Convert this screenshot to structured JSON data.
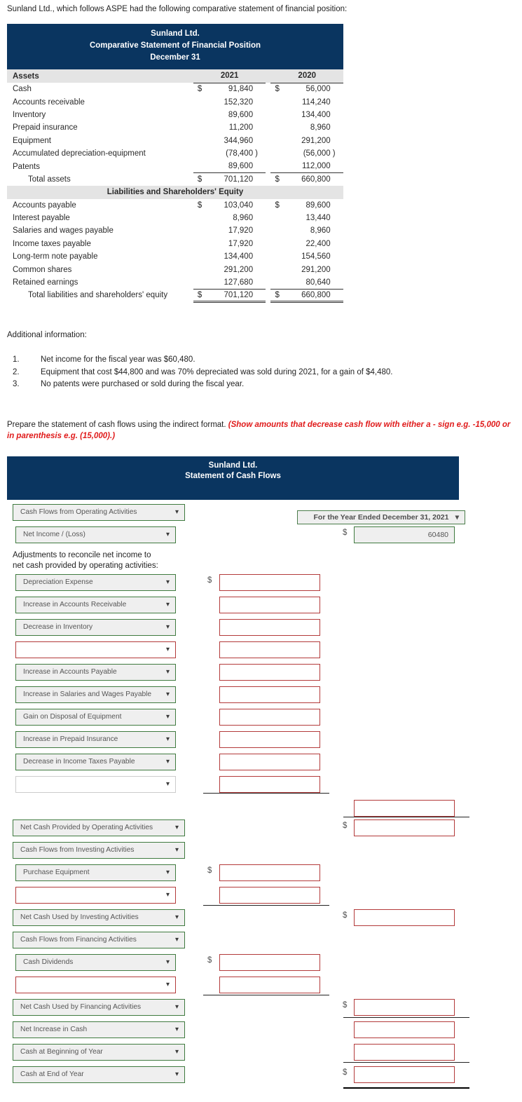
{
  "intro": "Sunland Ltd., which follows ASPE had the following comparative statement of financial position:",
  "balance_sheet": {
    "title_line1": "Sunland Ltd.",
    "title_line2": "Comparative Statement of Financial Position",
    "title_line3": "December 31",
    "col_header_label": "Assets",
    "year_2021": "2021",
    "year_2020": "2020",
    "section_band": "Liabilities and Shareholders' Equity",
    "currency": "$",
    "assets": [
      {
        "label": "Cash",
        "sym21": "$",
        "v21": "91,840",
        "p21": "",
        "sym20": "$",
        "v20": "56,000",
        "p20": ""
      },
      {
        "label": "Accounts receivable",
        "sym21": "",
        "v21": "152,320",
        "p21": "",
        "sym20": "",
        "v20": "114,240",
        "p20": ""
      },
      {
        "label": "Inventory",
        "sym21": "",
        "v21": "89,600",
        "p21": "",
        "sym20": "",
        "v20": "134,400",
        "p20": ""
      },
      {
        "label": "Prepaid insurance",
        "sym21": "",
        "v21": "11,200",
        "p21": "",
        "sym20": "",
        "v20": "8,960",
        "p20": ""
      },
      {
        "label": "Equipment",
        "sym21": "",
        "v21": "344,960",
        "p21": "",
        "sym20": "",
        "v20": "291,200",
        "p20": ""
      },
      {
        "label": "Accumulated depreciation-equipment",
        "sym21": "",
        "v21": "(78,400",
        "p21": ")",
        "sym20": "",
        "v20": "(56,000",
        "p20": ")"
      },
      {
        "label": "Patents",
        "sym21": "",
        "v21": "89,600",
        "p21": "",
        "sym20": "",
        "v20": "112,000",
        "p20": ""
      }
    ],
    "total_assets": {
      "label": "Total assets",
      "sym21": "$",
      "v21": "701,120",
      "sym20": "$",
      "v20": "660,800"
    },
    "liabilities": [
      {
        "label": "Accounts payable",
        "sym21": "$",
        "v21": "103,040",
        "sym20": "$",
        "v20": "89,600"
      },
      {
        "label": "Interest payable",
        "sym21": "",
        "v21": "8,960",
        "sym20": "",
        "v20": "13,440"
      },
      {
        "label": "Salaries and wages payable",
        "sym21": "",
        "v21": "17,920",
        "sym20": "",
        "v20": "8,960"
      },
      {
        "label": "Income taxes payable",
        "sym21": "",
        "v21": "17,920",
        "sym20": "",
        "v20": "22,400"
      },
      {
        "label": "Long-term note payable",
        "sym21": "",
        "v21": "134,400",
        "sym20": "",
        "v20": "154,560"
      },
      {
        "label": "Common shares",
        "sym21": "",
        "v21": "291,200",
        "sym20": "",
        "v20": "291,200"
      },
      {
        "label": "Retained earnings",
        "sym21": "",
        "v21": "127,680",
        "sym20": "",
        "v20": "80,640"
      }
    ],
    "total_liab_equity": {
      "label": "Total liabilities and shareholders' equity",
      "sym21": "$",
      "v21": "701,120",
      "sym20": "$",
      "v20": "660,800"
    }
  },
  "additional": {
    "heading": "Additional information:",
    "items": [
      {
        "num": "1.",
        "text": "Net income for the fiscal year was $60,480."
      },
      {
        "num": "2.",
        "text": "Equipment that cost $44,800 and was 70% depreciated was sold during 2021, for a gain of $4,480."
      },
      {
        "num": "3.",
        "text": "No patents were purchased or sold during the fiscal year."
      }
    ]
  },
  "prompt": {
    "text": "Prepare the statement of cash flows using the indirect format. ",
    "hint": "(Show amounts that decrease cash flow with either a - sign e.g. -15,000 or in parenthesis e.g. (15,000).)"
  },
  "cash_flow": {
    "title_line1": "Sunland Ltd.",
    "title_line2": "Statement of Cash Flows",
    "period": "For the Year Ended December 31, 2021",
    "adjustment_note_line1": "Adjustments to reconcile net income to",
    "adjustment_note_line2": "net cash provided by operating activities:",
    "currency": "$",
    "chevron": "⌄",
    "rows": [
      {
        "id": "r1",
        "select": "Cash Flows from Operating Activities",
        "select_style": "wide-green",
        "amount_col": null,
        "amount_value": "",
        "dollar": false
      },
      {
        "id": "r2",
        "select": "Net Income / (Loss)",
        "select_style": "item-green",
        "amount_col": 2,
        "amount_value": "60480",
        "amount_filled": true,
        "dollar": true
      },
      {
        "id": "r3",
        "select": "Depreciation Expense",
        "select_style": "item-green",
        "amount_col": 1,
        "amount_value": "",
        "dollar": true
      },
      {
        "id": "r4",
        "select": "Increase in Accounts Receivable",
        "select_style": "item-green",
        "amount_col": 1,
        "amount_value": "",
        "dollar": false
      },
      {
        "id": "r5",
        "select": "Decrease in Inventory",
        "select_style": "item-green",
        "amount_col": 1,
        "amount_value": "",
        "dollar": false
      },
      {
        "id": "r6",
        "select": "",
        "select_style": "item-blank-red",
        "amount_col": 1,
        "amount_value": "",
        "dollar": false
      },
      {
        "id": "r7",
        "select": "Increase in Accounts Payable",
        "select_style": "item-green",
        "amount_col": 1,
        "amount_value": "",
        "dollar": false
      },
      {
        "id": "r8",
        "select": "Increase in Salaries and Wages Payable",
        "select_style": "item-green",
        "amount_col": 1,
        "amount_value": "",
        "dollar": false
      },
      {
        "id": "r9",
        "select": "Gain on Disposal of Equipment",
        "select_style": "item-green",
        "amount_col": 1,
        "amount_value": "",
        "dollar": false
      },
      {
        "id": "r10",
        "select": "Increase in Prepaid Insurance",
        "select_style": "item-green",
        "amount_col": 1,
        "amount_value": "",
        "dollar": false
      },
      {
        "id": "r11",
        "select": "Decrease in Income Taxes Payable",
        "select_style": "item-green",
        "amount_col": 1,
        "amount_value": "",
        "dollar": false
      },
      {
        "id": "r12",
        "select": "",
        "select_style": "item-blank-grey",
        "amount_col": 1,
        "amount_value": "",
        "dollar": false
      },
      {
        "id": "r13",
        "select": null,
        "amount_col": 2,
        "amount_value": "",
        "dollar": false
      },
      {
        "id": "r14",
        "select": "Net Cash Provided by Operating Activities",
        "select_style": "wide-green",
        "amount_col": 2,
        "amount_value": "",
        "dollar": true
      },
      {
        "id": "r15",
        "select": "Cash Flows from Investing Activities",
        "select_style": "wide-green",
        "amount_col": null,
        "amount_value": "",
        "dollar": false
      },
      {
        "id": "r16",
        "select": "Purchase Equipment",
        "select_style": "item-green",
        "amount_col": 1,
        "amount_value": "",
        "dollar": true
      },
      {
        "id": "r17",
        "select": "",
        "select_style": "item-blank-red",
        "amount_col": 1,
        "amount_value": "",
        "dollar": false
      },
      {
        "id": "r18",
        "select": "Net Cash Used by Investing Activities",
        "select_style": "wide-green",
        "amount_col": 2,
        "amount_value": "",
        "dollar": true
      },
      {
        "id": "r19",
        "select": "Cash Flows from Financing Activities",
        "select_style": "wide-green",
        "amount_col": null,
        "amount_value": "",
        "dollar": false
      },
      {
        "id": "r20",
        "select": "Cash Dividends",
        "select_style": "item-green",
        "amount_col": 1,
        "amount_value": "",
        "dollar": true
      },
      {
        "id": "r21",
        "select": "",
        "select_style": "item-blank-red",
        "amount_col": 1,
        "amount_value": "",
        "dollar": false
      },
      {
        "id": "r22",
        "select": "Net Cash Used by Financing Activities",
        "select_style": "wide-green",
        "amount_col": 2,
        "amount_value": "",
        "dollar": true
      },
      {
        "id": "r23",
        "select": "Net Increase in Cash",
        "select_style": "wide-green",
        "amount_col": 2,
        "amount_value": "",
        "dollar": false
      },
      {
        "id": "r24",
        "select": "Cash at Beginning of Year",
        "select_style": "wide-green",
        "amount_col": 2,
        "amount_value": "",
        "dollar": false
      },
      {
        "id": "r25",
        "select": "Cash at End of Year",
        "select_style": "wide-green",
        "amount_col": 2,
        "amount_value": "",
        "dollar": true
      }
    ]
  }
}
